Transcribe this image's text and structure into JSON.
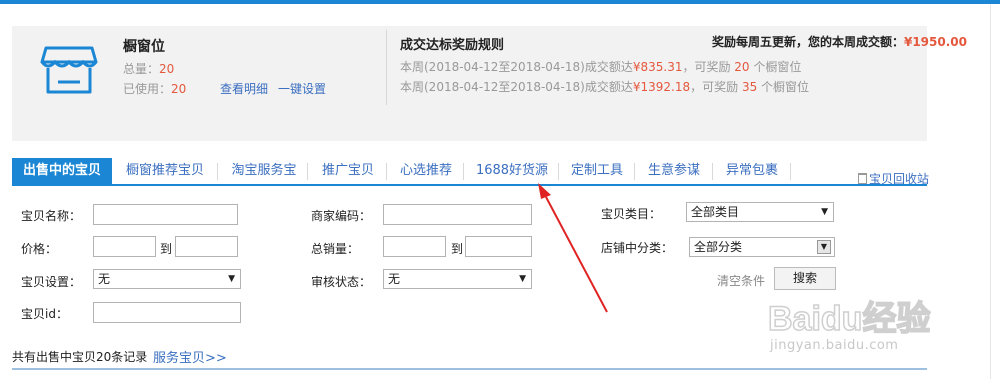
{
  "showcase": {
    "title": "橱窗位",
    "total_label": "总量：",
    "total_value": "20",
    "used_label": "已使用：",
    "used_value": "20",
    "view_detail": "查看明细",
    "one_click_setup": "一键设置"
  },
  "rules": {
    "title": "成交达标奖励规则",
    "reward_text": "奖励每周五更新，您的本周成交额：",
    "reward_amount": "¥1950.00",
    "line1_prefix": "本周(2018-04-12至2018-04-18)成交额达",
    "line1_amount": "¥835.31",
    "line1_mid": "，可奖励 ",
    "line1_count": "20",
    "line1_suffix": " 个橱窗位",
    "line2_prefix": "本周(2018-04-12至2018-04-18)成交额达",
    "line2_amount": "¥1392.18",
    "line2_mid": "，可奖励 ",
    "line2_count": "35",
    "line2_suffix": " 个橱窗位"
  },
  "tabs": [
    "出售中的宝贝",
    "橱窗推荐宝贝",
    "淘宝服务宝",
    "推广宝贝",
    "心选推荐",
    "1688好货源",
    "定制工具",
    "生意参谋",
    "异常包裹"
  ],
  "recycle_bin": "宝贝回收站",
  "filters": {
    "item_name": "宝贝名称：",
    "merchant_code": "商家编码：",
    "category": "宝贝类目：",
    "category_value": "全部类目",
    "price": "价格：",
    "to1": "到",
    "total_sales": "总销量：",
    "to2": "到",
    "shop_category": "店铺中分类：",
    "shop_category_value": "全部分类",
    "item_setting": "宝贝设置：",
    "item_setting_value": "无",
    "review_status": "审核状态：",
    "review_status_value": "无",
    "item_id": "宝贝id：",
    "clear": "清空条件",
    "search": "搜索"
  },
  "summary": {
    "count_text": "共有出售中宝贝20条记录",
    "service_link": "服务宝贝>>"
  },
  "watermark": {
    "brand": "Baidu经验",
    "url": "jingyan.baidu.com"
  },
  "colors": {
    "accent": "#1a86d4",
    "link": "#3b6fc0",
    "highlight": "#e4583e",
    "arrow": "#e02424"
  }
}
